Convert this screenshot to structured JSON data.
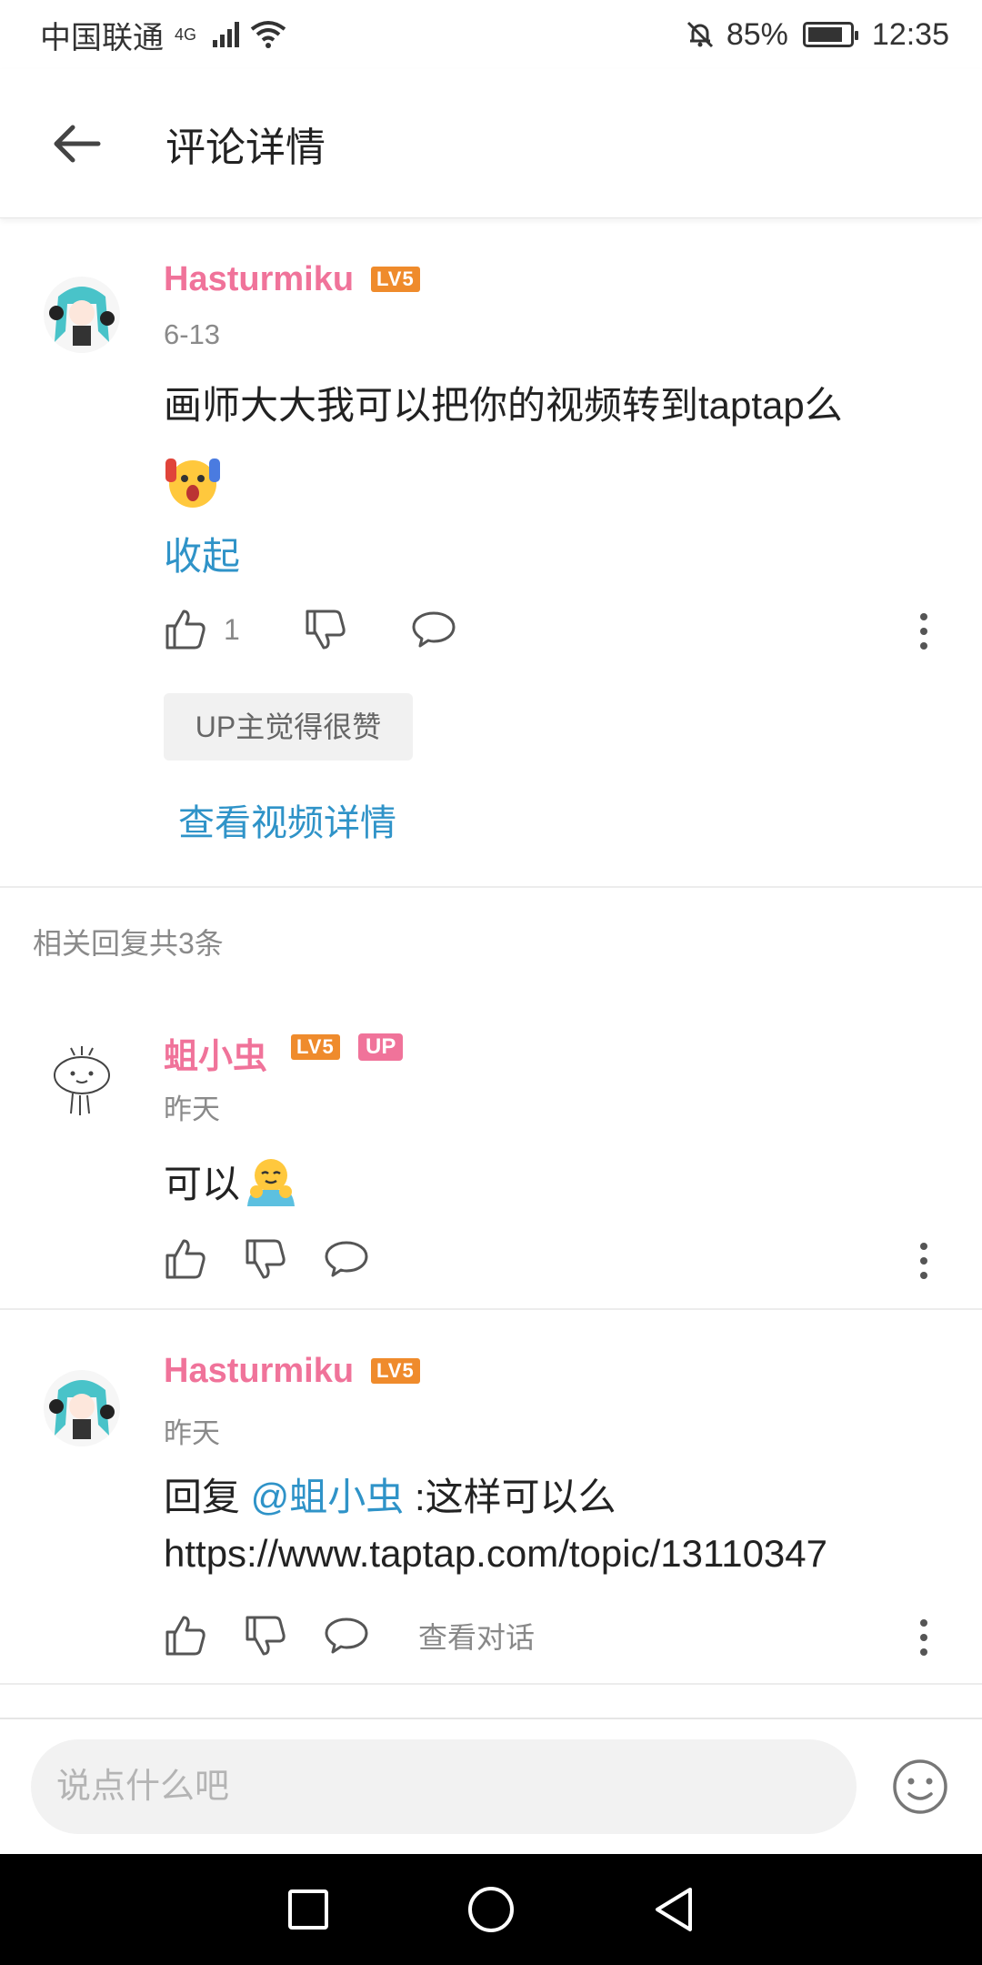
{
  "status_bar": {
    "carrier": "中国联通",
    "network": "4G",
    "battery": "85%",
    "time": "12:35"
  },
  "header": {
    "title": "评论详情"
  },
  "main_comment": {
    "username": "Hasturmiku",
    "level": "LV5",
    "date": "6-13",
    "text": "画师大大我可以把你的视频转到taptap么",
    "collapse_label": "收起",
    "like_count": "1",
    "tag": "UP主觉得很赞",
    "view_video_label": "查看视频详情"
  },
  "replies_header": "相关回复共3条",
  "replies": [
    {
      "username": "蛆小虫",
      "level": "LV5",
      "up_badge": "UP",
      "date": "昨天",
      "text": "可以"
    },
    {
      "username": "Hasturmiku",
      "level": "LV5",
      "date": "昨天",
      "reply_prefix": "回复 ",
      "mention": "@蛆小虫",
      "text": " :这样可以么",
      "url": "https://www.taptap.com/topic/13110347",
      "view_conversation_label": "查看对话"
    }
  ],
  "input": {
    "placeholder": "说点什么吧"
  },
  "colors": {
    "username": "#f0739a",
    "link": "#2f93c8",
    "level_badge": "#ef8b2c"
  }
}
